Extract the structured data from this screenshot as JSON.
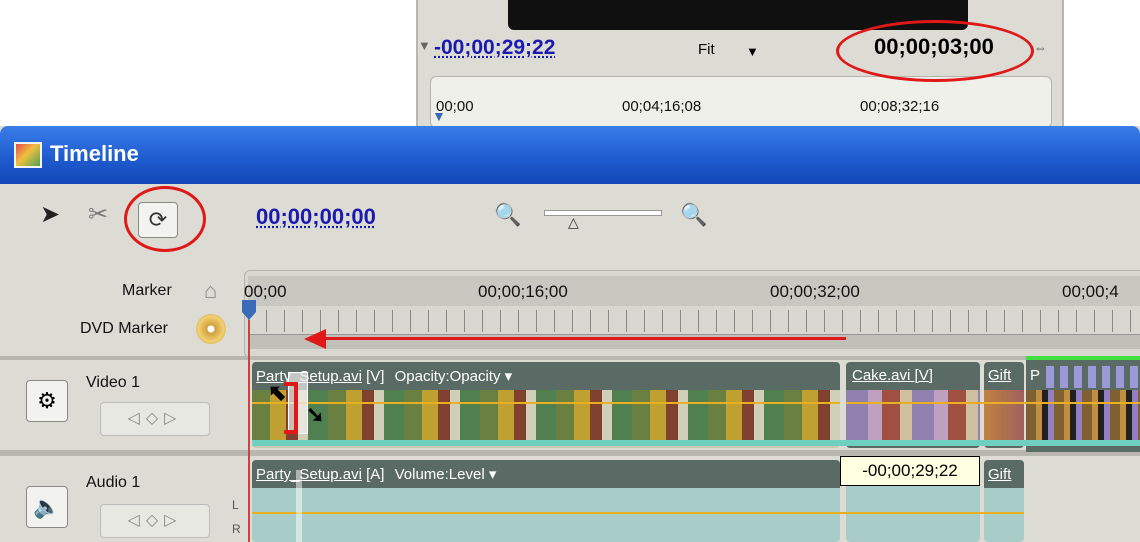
{
  "monitor": {
    "left_timecode": "-00;00;29;22",
    "fit_label": "Fit",
    "right_timecode": "00;00;03;00",
    "ruler_times": [
      "00;00",
      "00;04;16;08",
      "00;08;32;16"
    ]
  },
  "window": {
    "title": "Timeline"
  },
  "toolbar": {
    "timecode": "00;00;00;00"
  },
  "ruler": {
    "times": [
      "00;00",
      "00;00;16;00",
      "00;00;32;00",
      "00;00;4"
    ],
    "marker_label": "Marker",
    "dvd_marker_label": "DVD Marker"
  },
  "tracks": {
    "video1": {
      "label": "Video 1",
      "clips": [
        {
          "name_a": "Party",
          "name_b": "_Setup.avi",
          "kind": "[V]",
          "effect": "Opacity:Opacity"
        },
        {
          "name": "Cake.avi",
          "kind": "[V]"
        },
        {
          "name": "Gift"
        },
        {
          "name": "P"
        }
      ]
    },
    "audio1": {
      "label": "Audio 1",
      "channel_L": "L",
      "channel_R": "R",
      "clips": [
        {
          "name_a": "Party",
          "name_b": "_Setup.avi",
          "kind": "[A]",
          "effect": "Volume:Level"
        },
        {
          "name": "Gift"
        }
      ]
    }
  },
  "tooltip": "-00;00;29;22",
  "colors": {
    "highlight": "#e01818",
    "timecode_blue": "#1a1ab0",
    "titlebar": "#1e5cd0"
  }
}
